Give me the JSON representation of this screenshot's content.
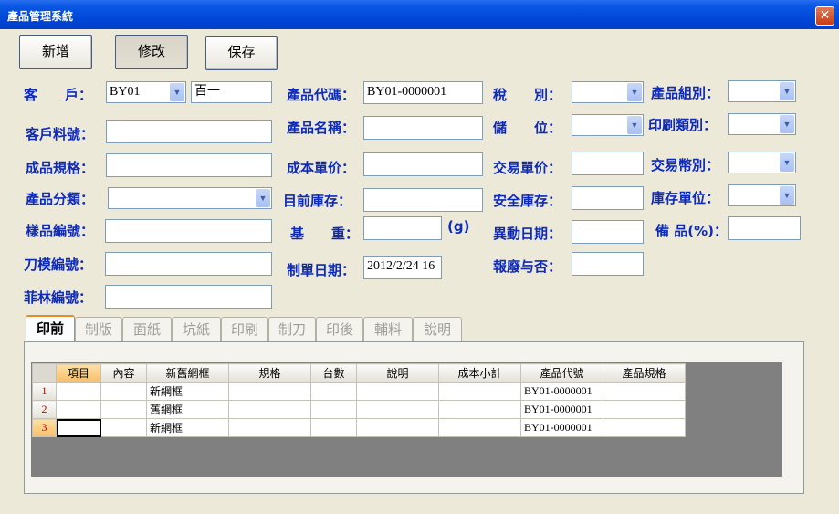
{
  "window": {
    "title": "產品管理系統",
    "close_label": "✕"
  },
  "toolbar": {
    "new": "新增",
    "edit": "修改",
    "save": "保存"
  },
  "form": {
    "customer_label": "客　　戶：",
    "customer_code": "BY01",
    "customer_name": "百一",
    "customer_item_no_label": "客戶料號：",
    "finished_spec_label": "成品規格：",
    "product_category_label": "產品分類：",
    "sample_no_label": "樣品編號：",
    "die_no_label": "刀模編號：",
    "film_no_label": "菲林編號：",
    "product_code_label": "產品代碼：",
    "product_code": "BY01-0000001",
    "product_name_label": "產品名稱：",
    "unit_cost_label": "成本單价：",
    "current_stock_label": "目前庫存：",
    "basis_weight_label": "基　　重：",
    "weight_unit": "(g)",
    "created_date_label": "制單日期：",
    "created_date": "2012/2/24 16",
    "tax_label": "稅　　別：",
    "storage_label": "儲　　位：",
    "trade_price_label": "交易單价：",
    "safety_stock_label": "安全庫存：",
    "change_date_label": "異動日期：",
    "scrapped_label": "報廢与否：",
    "product_group_label": "產品組別：",
    "print_type_label": "印刷類別：",
    "trade_currency_label": "交易幣別：",
    "stock_unit_label": "庫存單位：",
    "spare_pct_label": "備 品(%)："
  },
  "tabs": [
    "印前",
    "制版",
    "面紙",
    "坑紙",
    "印刷",
    "制刀",
    "印後",
    "輔料",
    "說明"
  ],
  "grid": {
    "headers": [
      "項目",
      "內容",
      "新舊網框",
      "規格",
      "台數",
      "說明",
      "成本小計",
      "產品代號",
      "產品規格"
    ],
    "rows": [
      {
        "num": "1",
        "frame": "新網框",
        "code": "BY01-0000001"
      },
      {
        "num": "2",
        "frame": "舊網框",
        "code": "BY01-0000001"
      },
      {
        "num": "3",
        "frame": "新網框",
        "code": "BY01-0000001"
      }
    ]
  },
  "colors": {
    "label": "#0d2ab8",
    "titlebar": "#0045d6",
    "active_tab": "#e68b2c"
  }
}
